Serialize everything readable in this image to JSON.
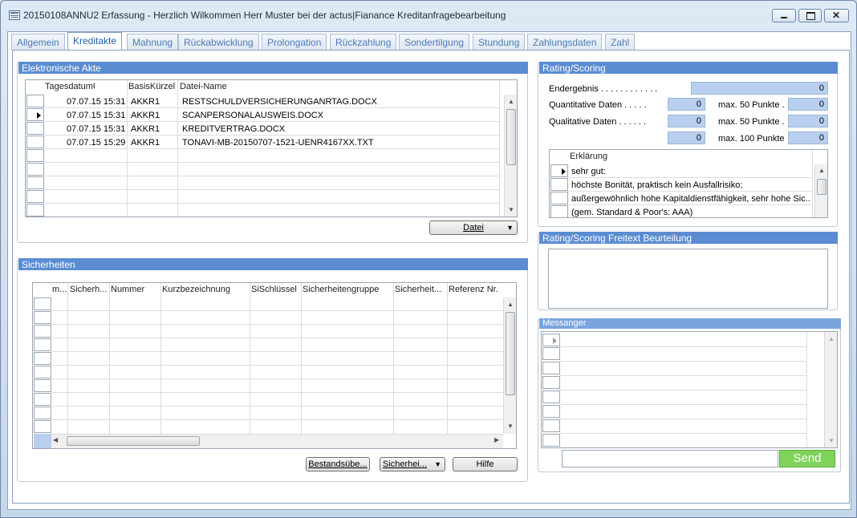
{
  "window": {
    "title": "20150108ANNU2 Erfassung - Herzlich Wilkommen Herr Muster bei der actus|Fianance Kreditanfragebearbeitung"
  },
  "tabs": [
    "Allgemein",
    "Kreditakte",
    "Mahnung",
    "Rückabwicklung",
    "Prolongation",
    "Rückzahlung",
    "Sondertilgung",
    "Stundung",
    "Zahlungsdaten",
    "Zahl"
  ],
  "active_tab": "Kreditakte",
  "akte": {
    "title": "Elektronische Akte",
    "columns": [
      "TagesdatumUhrzeit",
      "BasisKürzel",
      "Datei-Name"
    ],
    "rows": [
      [
        "07.07.15 15:31",
        "AKKR1",
        "RESTSCHULDVERSICHERUNGANRTAG.DOCX"
      ],
      [
        "07.07.15 15:31",
        "AKKR1",
        "SCANPERSONALAUSWEIS.DOCX"
      ],
      [
        "07.07.15 15:31",
        "AKKR1",
        "KREDITVERTRAG.DOCX"
      ],
      [
        "07.07.15 15:29",
        "AKKR1",
        "TONAVI-MB-20150707-1521-UENR4167XX.TXT"
      ]
    ],
    "file_button": "Datei"
  },
  "sicherheiten": {
    "title": "Sicherheiten",
    "columns": [
      "m...",
      "Sicherh...",
      "Nummer",
      "Kurzbezeichnung",
      "SiSchlüssel",
      "Sicherheitengruppe",
      "Sicherheit...",
      "Referenz Nr."
    ],
    "buttons": {
      "bestand": "Bestandsübe...",
      "sicher": "Sicherhei...",
      "hilfe": "Hilfe"
    }
  },
  "rating": {
    "title": "Rating/Scoring",
    "endergebnis_label": "Endergebnis . . . . . . . . . . . .",
    "endergebnis": "0",
    "quant_label": "Quantitative Daten . . . . .",
    "quant": "0",
    "quant_max_label": "max. 50 Punkte .",
    "quant_max": "0",
    "qual_label": "Qualitative Daten . . . . . .",
    "qual": "0",
    "qual_max_label": "max. 50 Punkte .",
    "qual_max": "0",
    "sum": "0",
    "sum_max_label": "max. 100 Punkte",
    "sum_max": "0",
    "erkl_header": "Erklärung",
    "erkl_rows": [
      "sehr gut:",
      "höchste Bonität, praktisch kein Ausfallrisiko;",
      "außergewöhnlich hohe Kapitaldienstfähigkeit, sehr hohe Sic...",
      "(gem. Standard & Poor's: AAA)"
    ]
  },
  "freitext": {
    "title": "Rating/Scoring  Freitext Beurteilung"
  },
  "messanger": {
    "title": "Messanger",
    "send": "Send"
  },
  "colors": {
    "section_header": "#5b8cd2",
    "field": "#b8cfef",
    "send": "#7fd35a"
  }
}
